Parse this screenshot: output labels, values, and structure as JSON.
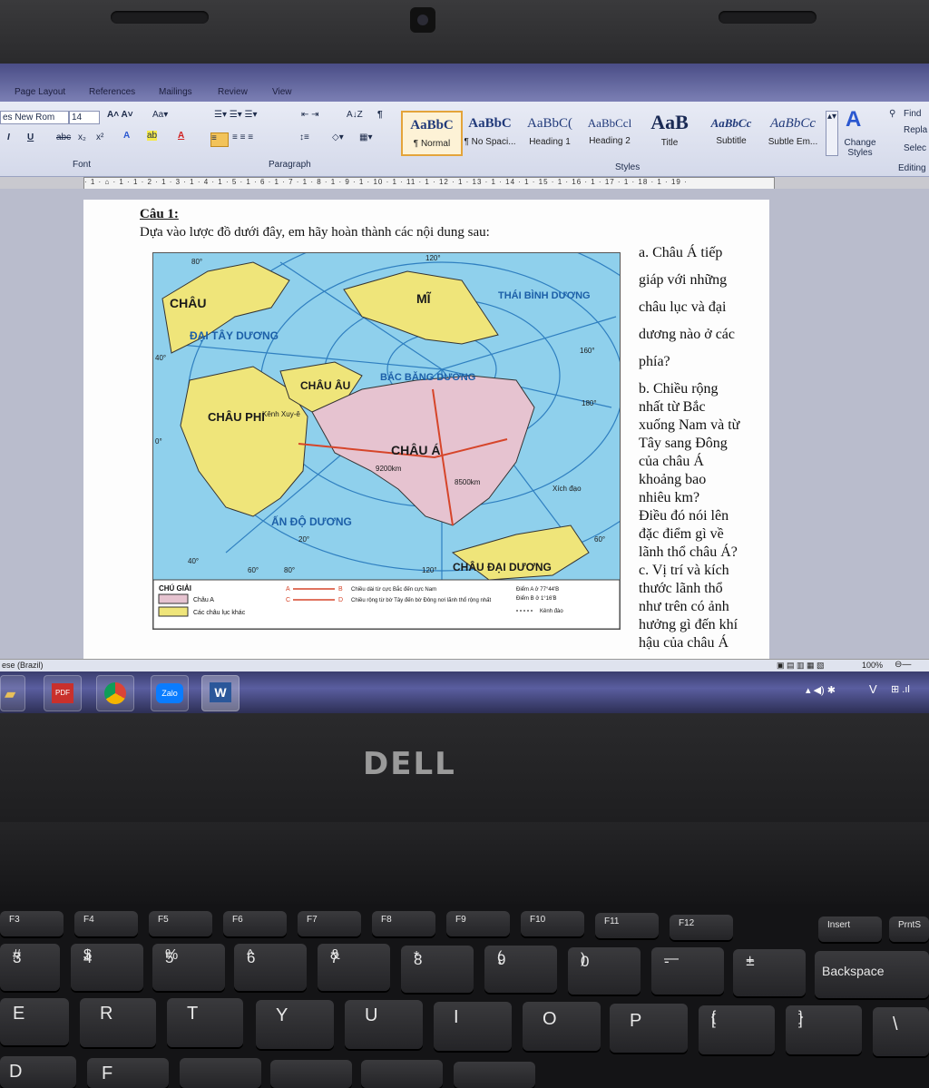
{
  "ribbon": {
    "tabs": [
      "Page Layout",
      "References",
      "Mailings",
      "Review",
      "View"
    ],
    "font_name": "es New Rom",
    "font_size": "14",
    "group_font": "Font",
    "group_paragraph": "Paragraph",
    "group_styles": "Styles",
    "group_editing": "Editing",
    "styles": [
      {
        "preview": "AaBbC",
        "name": "¶ Normal"
      },
      {
        "preview": "AaBbC",
        "name": "¶ No Spaci..."
      },
      {
        "preview": "AaBbC(",
        "name": "Heading 1"
      },
      {
        "preview": "AaBbCcl",
        "name": "Heading 2"
      },
      {
        "preview": "AaB",
        "name": "Title"
      },
      {
        "preview": "AaBbCc",
        "name": "Subtitle"
      },
      {
        "preview": "AaBbCc",
        "name": "Subtle Em..."
      }
    ],
    "change_styles": "Change Styles",
    "find": "Find",
    "replace": "Repla",
    "select": "Selec"
  },
  "document": {
    "question_title": "Câu 1:",
    "question_intro": "Dựa vào lược đồ dưới đây, em hãy hoàn thành các nội dung sau:",
    "side_lines": [
      "a. Châu Á tiếp",
      "giáp với những",
      "châu lục và đại",
      "dương nào ở các",
      "phía?",
      "b. Chiều rộng",
      "nhất từ Bắc",
      "xuống Nam và từ",
      "Tây sang Đông",
      "của châu Á",
      "khoảng bao",
      "nhiêu km?",
      "Điều đó nói lên",
      "đặc điểm gì về",
      "lãnh thổ châu Á?",
      "c. Vị trí và kích",
      "thước lãnh thổ",
      "như trên có ảnh",
      "hưởng gì đến khí",
      "hậu của châu Á"
    ]
  },
  "map": {
    "labels": {
      "chau_my": "CHÂU",
      "mi": "MĨ",
      "dai_tay_duong": "ĐẠI TÂY DƯƠNG",
      "thai_binh_duong": "THÁI BÌNH DƯƠNG",
      "bac_bang_duong": "BẮC BĂNG DƯƠNG",
      "chau_au": "CHÂU ÂU",
      "chau_phi": "CHÂU PHI",
      "chau_a": "CHÂU Á",
      "an_do_duong": "ẤN ĐỘ DƯƠNG",
      "chau_dai_duong": "CHÂU ĐẠI DƯƠNG",
      "kenh_xuyee": "Kênh Xuy-ê",
      "dist_ew": "9200km",
      "dist_ns": "8500km",
      "xich_dao": "Xích đạo",
      "A": "A",
      "B": "B",
      "C": "C",
      "D": "D"
    },
    "degrees": [
      "120°",
      "160°",
      "180°",
      "80°",
      "40°",
      "0°",
      "20°",
      "40°",
      "60°",
      "80°",
      "120°",
      "60°"
    ],
    "legend": {
      "title": "CHÚ GIẢI",
      "chau_a": "Châu A",
      "other": "Các châu lục khác",
      "ab": "Chiều dài từ cực Bắc đến cực Nam",
      "cd": "Chiều rộng từ bờ Tây đến bờ Đông nơi lãnh thổ rộng nhất",
      "point_a": "Điểm A ở 77°44'B",
      "point_b": "Điểm B ở 1°16'B",
      "canal": "Kênh đào"
    }
  },
  "statusbar": {
    "language": "ese (Brazil)",
    "zoom": "100%"
  },
  "taskbar": {
    "apps": [
      "explorer",
      "pdf",
      "chrome",
      "Zalo",
      "W"
    ],
    "tray": "V"
  },
  "laptop": {
    "brand": "DELL"
  },
  "keyboard": {
    "fkeys": [
      "F3",
      "F4",
      "F5",
      "F6",
      "F7",
      "F8",
      "F9",
      "F10",
      "F11",
      "F12",
      "Insert",
      "PrntS"
    ],
    "numrow": [
      [
        "#",
        "3"
      ],
      [
        "$",
        "4"
      ],
      [
        "%",
        "5"
      ],
      [
        "^",
        "6"
      ],
      [
        "&",
        "7"
      ],
      [
        "*",
        "8"
      ],
      [
        "(",
        "9"
      ],
      [
        ")",
        "0"
      ],
      [
        "—",
        "-"
      ],
      [
        "+",
        "="
      ]
    ],
    "backspace": "Backspace",
    "letters": [
      "E",
      "R",
      "T",
      "Y",
      "U",
      "I",
      "O",
      "P"
    ],
    "brackets": [
      [
        "{",
        "["
      ],
      [
        "}",
        "]"
      ]
    ],
    "bottom": [
      "D",
      "F"
    ]
  },
  "colors": {
    "ocean": "#8fd0ec",
    "land_other": "#efe57a",
    "land_asia": "#e6c3d0",
    "grid": "#2f7fc0",
    "route": "#d6452a"
  }
}
